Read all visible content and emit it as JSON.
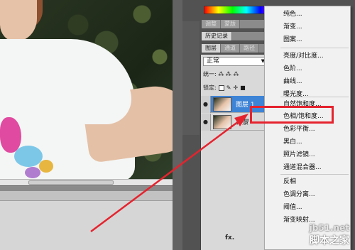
{
  "panels": {
    "adjust_tabs": [
      {
        "label": "调整"
      },
      {
        "label": "蒙版"
      }
    ],
    "history_tab": "历史记录",
    "layers_tabs": [
      {
        "label": "图层"
      },
      {
        "label": "通道"
      },
      {
        "label": "路径"
      }
    ],
    "blend_mode": "正常",
    "unify_label": "统一:",
    "lock_label": "锁定:",
    "layers": [
      {
        "name": "图层 1",
        "selected": true
      },
      {
        "name": "背景",
        "selected": false
      }
    ],
    "bottom_icon_label": "fx."
  },
  "menu": {
    "groups": [
      [
        "纯色...",
        "渐变...",
        "图案..."
      ],
      [
        "亮度/对比度...",
        "色阶...",
        "曲线...",
        "曝光度..."
      ],
      [
        "自然饱和度...",
        "色相/饱和度...",
        "色彩平衡...",
        "黑白...",
        "照片滤镜...",
        "通道混合器..."
      ],
      [
        "反相",
        "色调分离...",
        "阈值...",
        "渐变映射..."
      ]
    ],
    "highlighted_item": "色相/饱和度..."
  },
  "watermark": {
    "line1": "jb51.net",
    "line2": "脚本之家"
  },
  "colors": {
    "highlight": "#e5232e",
    "selection": "#3d83d6"
  }
}
